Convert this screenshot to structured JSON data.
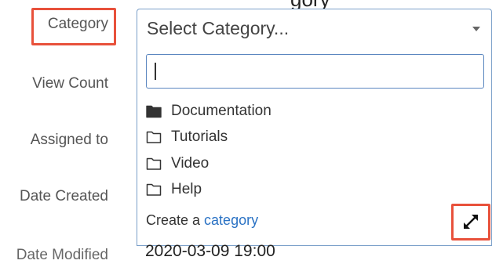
{
  "heading_clipped": "gory",
  "labels": {
    "category": "Category",
    "view_count": "View Count",
    "assigned_to": "Assigned to",
    "date_created": "Date Created",
    "date_modified": "Date Modified"
  },
  "category_select": {
    "selected": "Select Category...",
    "caret_icon": "caret-down-icon"
  },
  "dropdown": {
    "search_value": "",
    "items": [
      {
        "label": "Documentation",
        "icon": "folder-filled-icon"
      },
      {
        "label": "Tutorials",
        "icon": "folder-outline-icon"
      },
      {
        "label": "Video",
        "icon": "folder-outline-icon"
      },
      {
        "label": "Help",
        "icon": "folder-outline-icon"
      }
    ],
    "create_prefix": "Create a ",
    "create_link": "category",
    "resize_icon": "expand-arrows-icon"
  },
  "date_modified_value": "2020-03-09 19:00",
  "colors": {
    "highlight": "#e8513b",
    "link": "#2a72c4",
    "focus_border": "#5a86bf"
  }
}
